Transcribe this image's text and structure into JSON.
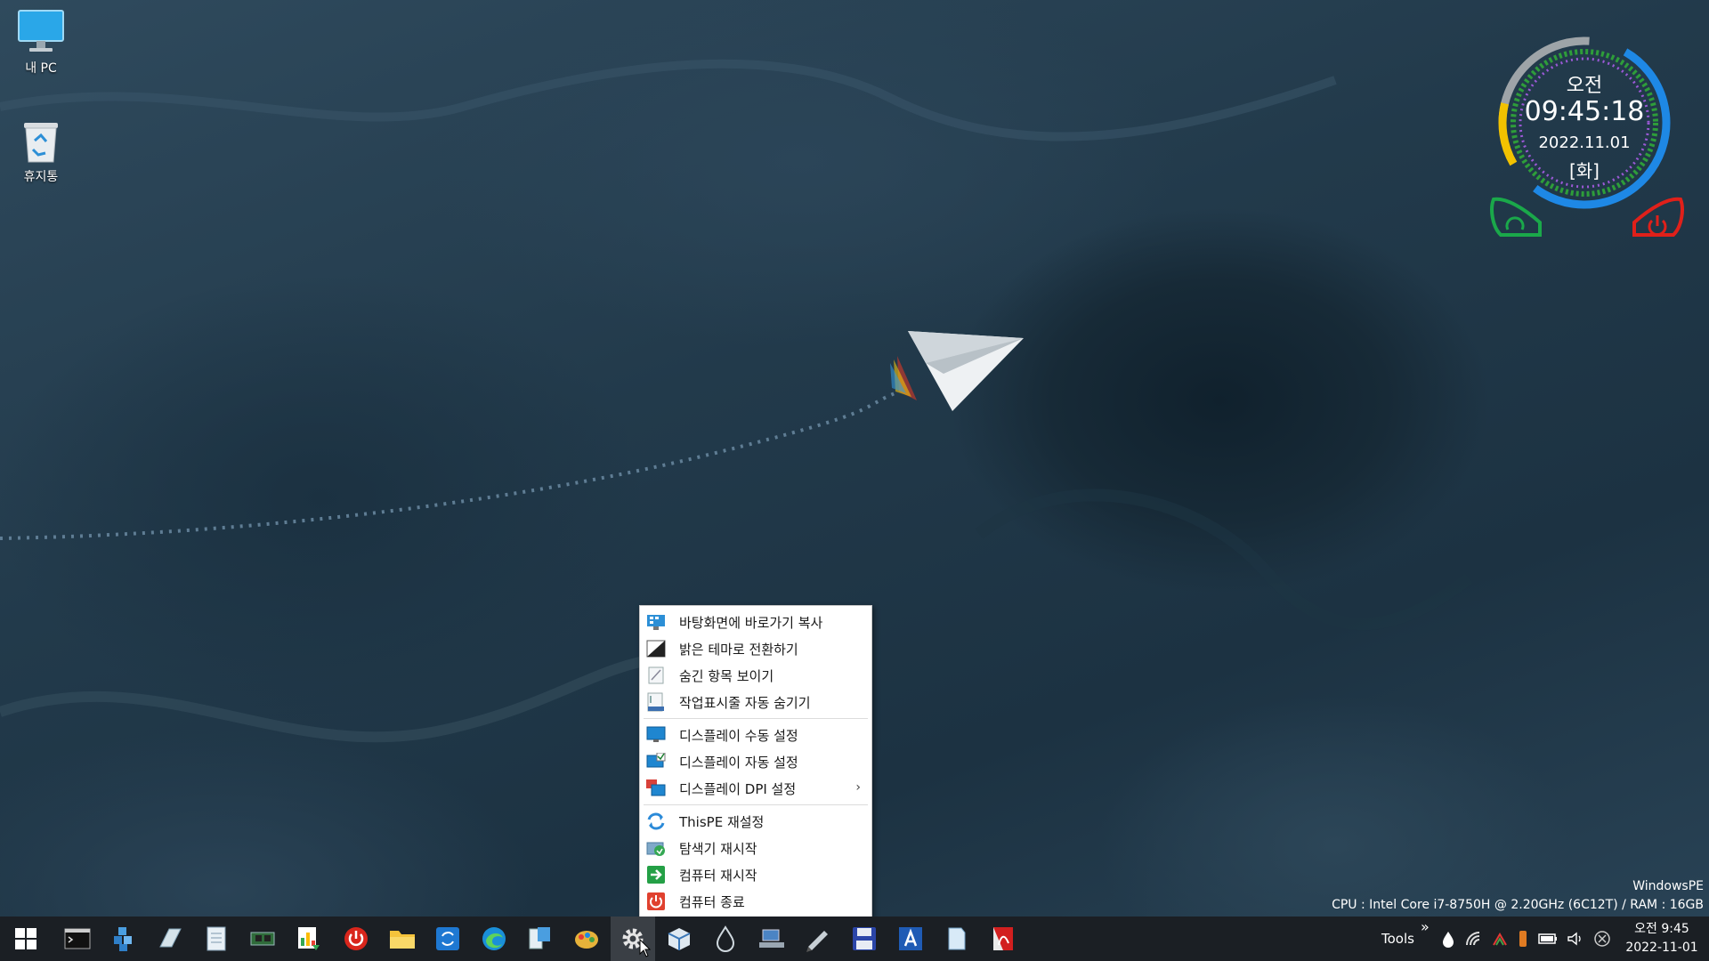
{
  "desktop": {
    "icons": [
      {
        "label": "내 PC"
      },
      {
        "label": "휴지통"
      }
    ]
  },
  "clock": {
    "ampm": "오전",
    "time": "09:45:18",
    "date": "2022.11.01",
    "weekday": "[화]"
  },
  "context_menu": {
    "items": [
      {
        "label": "바탕화면에 바로가기 복사",
        "icon": "desktop-shortcut-icon"
      },
      {
        "label": "밝은 테마로 전환하기",
        "icon": "theme-icon"
      },
      {
        "label": "숨긴 항목 보이기",
        "icon": "hidden-items-icon"
      },
      {
        "label": "작업표시줄 자동 숨기기",
        "icon": "taskbar-hide-icon"
      },
      {
        "label": "디스플레이 수동 설정",
        "icon": "monitor-icon"
      },
      {
        "label": "디스플레이 자동 설정",
        "icon": "monitor-check-icon"
      },
      {
        "label": "디스플레이 DPI 설정",
        "icon": "dpi-icon",
        "submenu_glyph": "›"
      },
      {
        "label": "ThisPE 재설정",
        "icon": "refresh-icon"
      },
      {
        "label": "탐색기 재시작",
        "icon": "explorer-restart-icon"
      },
      {
        "label": "컴퓨터 재시작",
        "icon": "restart-icon"
      },
      {
        "label": "컴퓨터 종료",
        "icon": "shutdown-icon"
      }
    ]
  },
  "sysinfo": {
    "os": "WindowsPE",
    "hardware": "CPU : Intel Core i7-8750H @ 2.20GHz (6C12T) / RAM : 16GB"
  },
  "taskbar": {
    "tools_label": "Tools",
    "overflow_glyph": "»",
    "tray_time": "오전 9:45",
    "tray_date": "2022-11-01",
    "apps": [
      "start-icon",
      "cmd-icon",
      "registry-icon",
      "eraser-icon",
      "notepad-icon",
      "hardware-icon",
      "task-manager-icon",
      "power-icon",
      "folder-icon",
      "sync-icon",
      "edge-icon",
      "explorer-icon",
      "paint-icon",
      "settings-icon",
      "package-icon",
      "drop-icon",
      "network-share-icon",
      "pen-icon",
      "save-icon",
      "font-icon",
      "doc-icon",
      "pdf-icon"
    ]
  },
  "colors": {
    "taskbar_bg": "#1b1f24",
    "menu_bg": "#ffffff",
    "clock_ring_blue": "#1e88e5",
    "clock_ring_green": "#2e9d3a",
    "clock_ring_yellow": "#f2c200",
    "restart_green": "#1aa84a",
    "shutdown_red": "#e0201a"
  }
}
